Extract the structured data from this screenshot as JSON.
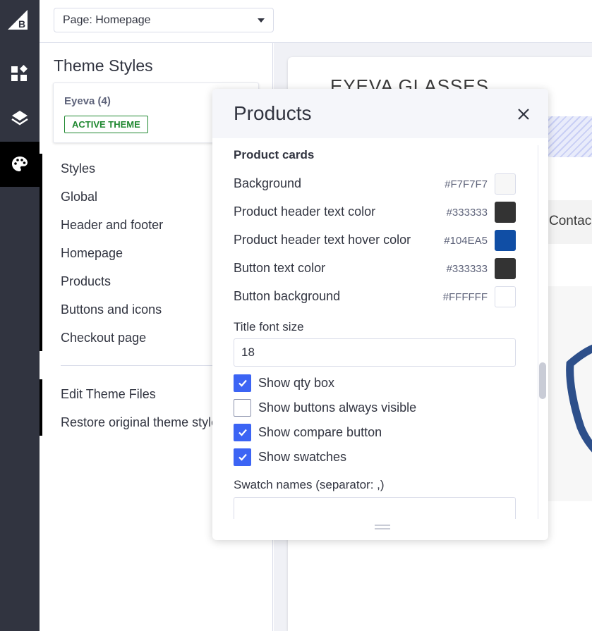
{
  "topbar": {
    "page_select": "Page: Homepage"
  },
  "rail": {
    "icons": [
      "bigcommerce-logo",
      "widgets-icon",
      "layers-icon",
      "palette-icon"
    ]
  },
  "panel": {
    "title": "Theme Styles",
    "theme": {
      "name": "Eyeva (4)",
      "badge": "ACTIVE THEME"
    },
    "nav_items": [
      "Styles",
      "Global",
      "Header and footer",
      "Homepage",
      "Products",
      "Buttons and icons",
      "Checkout page"
    ],
    "secondary_items": [
      "Edit Theme Files",
      "Restore original theme styles"
    ]
  },
  "preview": {
    "store_title": "EYEVA GLASSES",
    "nav_link": "Contac"
  },
  "modal": {
    "title": "Products",
    "section": "Product cards",
    "colors": [
      {
        "label": "Background",
        "hex": "#F7F7F7"
      },
      {
        "label": "Product header text color",
        "hex": "#333333"
      },
      {
        "label": "Product header text hover color",
        "hex": "#104EA5"
      },
      {
        "label": "Button text color",
        "hex": "#333333"
      },
      {
        "label": "Button background",
        "hex": "#FFFFFF"
      }
    ],
    "title_font_size": {
      "label": "Title font size",
      "value": "18"
    },
    "checkboxes": [
      {
        "label": "Show qty box",
        "checked": true
      },
      {
        "label": "Show buttons always visible",
        "checked": false
      },
      {
        "label": "Show compare button",
        "checked": true
      },
      {
        "label": "Show swatches",
        "checked": true
      }
    ],
    "swatch_names": {
      "label": "Swatch names (separator: ,)",
      "value": ""
    }
  },
  "colors": {
    "rail": "#313440",
    "accent": "#3C64F4",
    "active_badge": "#208831"
  }
}
